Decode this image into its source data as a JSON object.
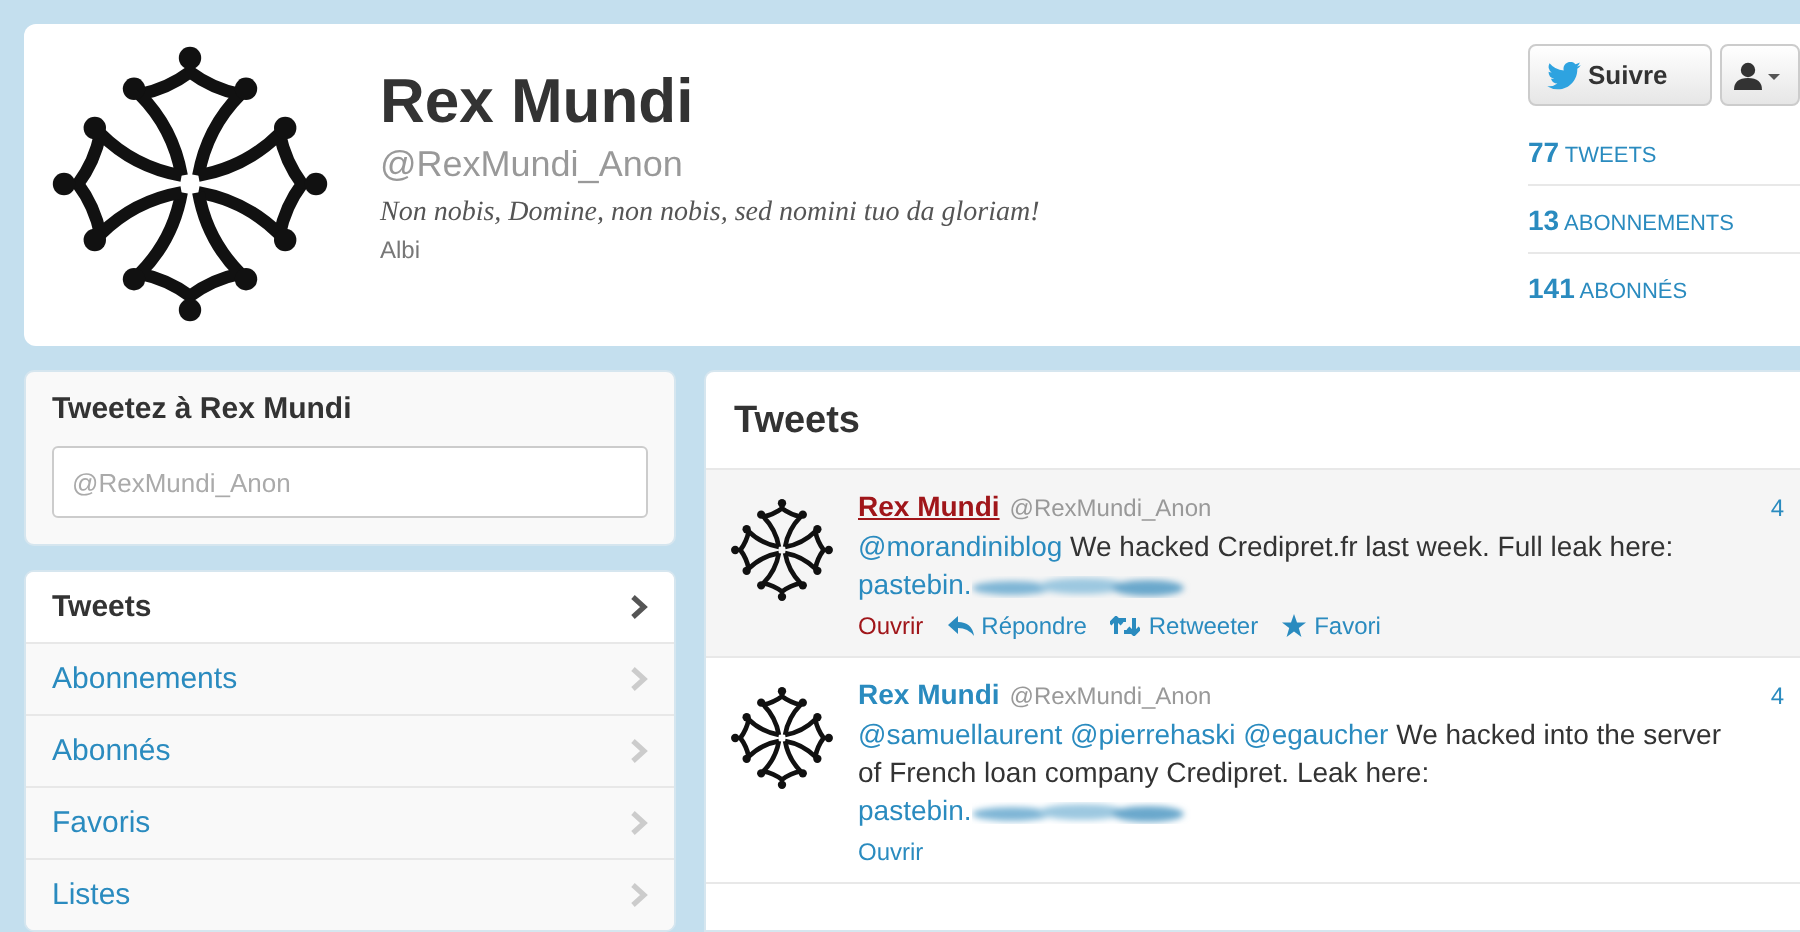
{
  "profile": {
    "name": "Rex Mundi",
    "handle": "@RexMundi_Anon",
    "bio": "Non nobis, Domine, non nobis, sed nomini tuo da gloriam!",
    "location": "Albi"
  },
  "follow_button": {
    "label": "Suivre"
  },
  "stats": [
    {
      "count": "77",
      "label": "TWEETS"
    },
    {
      "count": "13",
      "label": "ABONNEMENTS"
    },
    {
      "count": "141",
      "label": "ABONNÉS"
    }
  ],
  "compose": {
    "title": "Tweetez à Rex Mundi",
    "placeholder": "@RexMundi_Anon"
  },
  "nav": [
    {
      "label": "Tweets",
      "selected": true
    },
    {
      "label": "Abonnements",
      "selected": false
    },
    {
      "label": "Abonnés",
      "selected": false
    },
    {
      "label": "Favoris",
      "selected": false
    },
    {
      "label": "Listes",
      "selected": false
    }
  ],
  "stream": {
    "title": "Tweets",
    "tweets": [
      {
        "name": "Rex Mundi",
        "handle": "@RexMundi_Anon",
        "time": "4",
        "selected": true,
        "segments": [
          {
            "kind": "mention",
            "text": "@morandiniblog"
          },
          {
            "kind": "text",
            "text": " We hacked Credipret.fr last week. Full leak here: "
          },
          {
            "kind": "redacted_link",
            "text": "pastebin."
          }
        ],
        "actions": [
          {
            "kind": "open",
            "label": "Ouvrir"
          },
          {
            "kind": "reply",
            "label": "Répondre"
          },
          {
            "kind": "retweet",
            "label": "Retweeter"
          },
          {
            "kind": "favorite",
            "label": "Favori"
          }
        ]
      },
      {
        "name": "Rex Mundi",
        "handle": "@RexMundi_Anon",
        "time": "4",
        "selected": false,
        "segments": [
          {
            "kind": "mention",
            "text": "@samuellaurent "
          },
          {
            "kind": "mention",
            "text": "@pierrehaski "
          },
          {
            "kind": "mention",
            "text": "@egaucher"
          },
          {
            "kind": "text",
            "text": " We hacked into the server of French loan company Credipret. Leak here: "
          },
          {
            "kind": "redacted_link",
            "text": "pastebin."
          }
        ],
        "actions": [
          {
            "kind": "open",
            "label": "Ouvrir"
          }
        ]
      }
    ]
  }
}
